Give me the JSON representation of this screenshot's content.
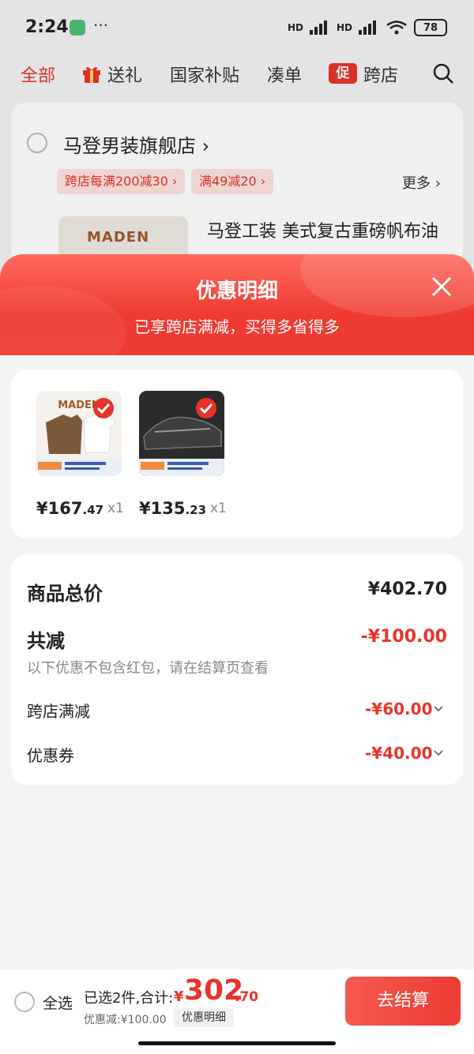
{
  "status_bar": {
    "time": "2:24",
    "dots": "···",
    "signal1": "HD",
    "signal2": "HD",
    "battery": "78"
  },
  "tabs": [
    {
      "label": "全部"
    },
    {
      "label": "送礼"
    },
    {
      "label": "国家补贴"
    },
    {
      "label": "凑单"
    },
    {
      "label": "跨店"
    }
  ],
  "promo_badge": "促",
  "store": {
    "name": "马登男装旗舰店 ›",
    "chips": [
      "跨店每满200减30 ›",
      "满49减20 ›"
    ],
    "more": "更多 ›",
    "logo_text": "MADEN",
    "product_title": "马登工装 美式复古重磅帆布油"
  },
  "sheet": {
    "title": "优惠明细",
    "subtitle": "已享跨店满减，买得多省得多"
  },
  "items": [
    {
      "price_int": "¥167",
      "price_dec": ".47",
      "qty": "x1"
    },
    {
      "price_int": "¥135",
      "price_dec": ".23",
      "qty": "x1"
    }
  ],
  "summary": {
    "total_label": "商品总价",
    "total_value": "¥402.70",
    "reduce_label": "共减",
    "reduce_value": "-¥100.00",
    "note": "以下优惠不包含红包，请在结算页查看",
    "rows": [
      {
        "label": "跨店满减",
        "value": "-¥60.00"
      },
      {
        "label": "优惠券",
        "value": "-¥40.00"
      }
    ]
  },
  "bottom": {
    "select_all": "全选",
    "selected_text": "已选2件,合计:",
    "total_prefix": "¥",
    "total_int": "302",
    "total_dec": ".70",
    "discount_text": "优惠减:¥100.00",
    "detail_label": "优惠明细",
    "checkout": "去结算"
  },
  "colors": {
    "accent": "#e8332a",
    "background": "#f4f4f4"
  }
}
